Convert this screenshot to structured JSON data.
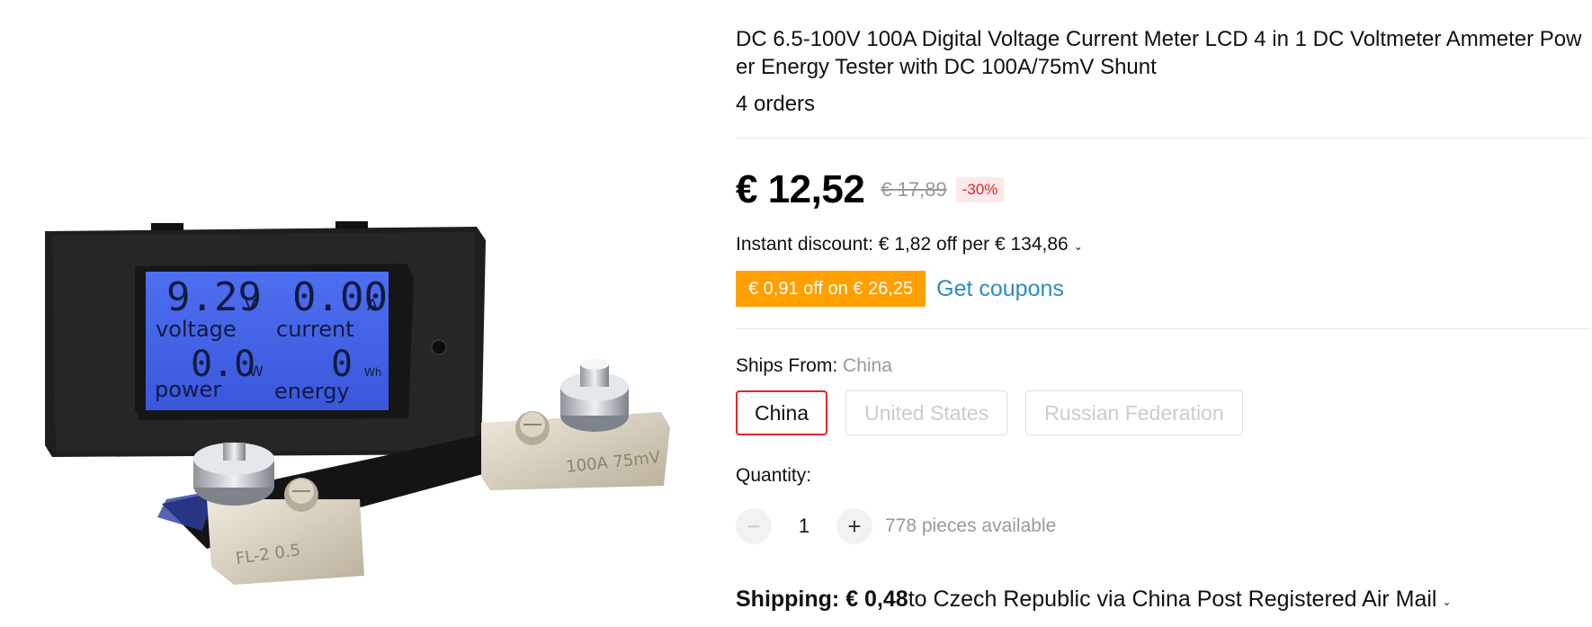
{
  "product": {
    "title": "DC 6.5-100V 100A Digital Voltage Current Meter LCD 4 in 1 DC Voltmeter Ammeter Power Energy Tester with DC 100A/75mV Shunt",
    "orders": "4 orders"
  },
  "price": {
    "current": "€ 12,52",
    "original": "€ 17,89",
    "discount": "-30%"
  },
  "instant_discount": {
    "text": "Instant discount: € 1,82 off per € 134,86"
  },
  "coupon": {
    "label": "€ 0,91 off on € 26,25",
    "link": "Get coupons"
  },
  "ships_from": {
    "label": "Ships From: ",
    "value": "China",
    "options": [
      "China",
      "United States",
      "Russian Federation"
    ],
    "selected": "China"
  },
  "quantity": {
    "label": "Quantity:",
    "value": "1",
    "minus": "−",
    "plus": "+",
    "available": "778 pieces available"
  },
  "shipping": {
    "label": "Shipping:",
    "price": "€ 0,48",
    "details": " to Czech Republic via China Post Registered Air Mail"
  },
  "lcd": {
    "voltage_value": "9.29",
    "voltage_unit": "V",
    "current_value": "0.00",
    "current_unit": "A",
    "voltage_label": "voltage",
    "current_label": "current",
    "power_value": "0.0",
    "power_unit": "W",
    "energy_value": "0",
    "energy_unit": "Wh",
    "power_label": "power",
    "energy_label": "energy",
    "shunt_left": "FL-2 0.5",
    "shunt_right": "100A 75mV"
  },
  "colors": {
    "accent_red": "#e5222c",
    "coupon_orange": "#ff9f00",
    "link_blue": "#2b8cc4",
    "lcd_blue": "#3f63e6"
  }
}
